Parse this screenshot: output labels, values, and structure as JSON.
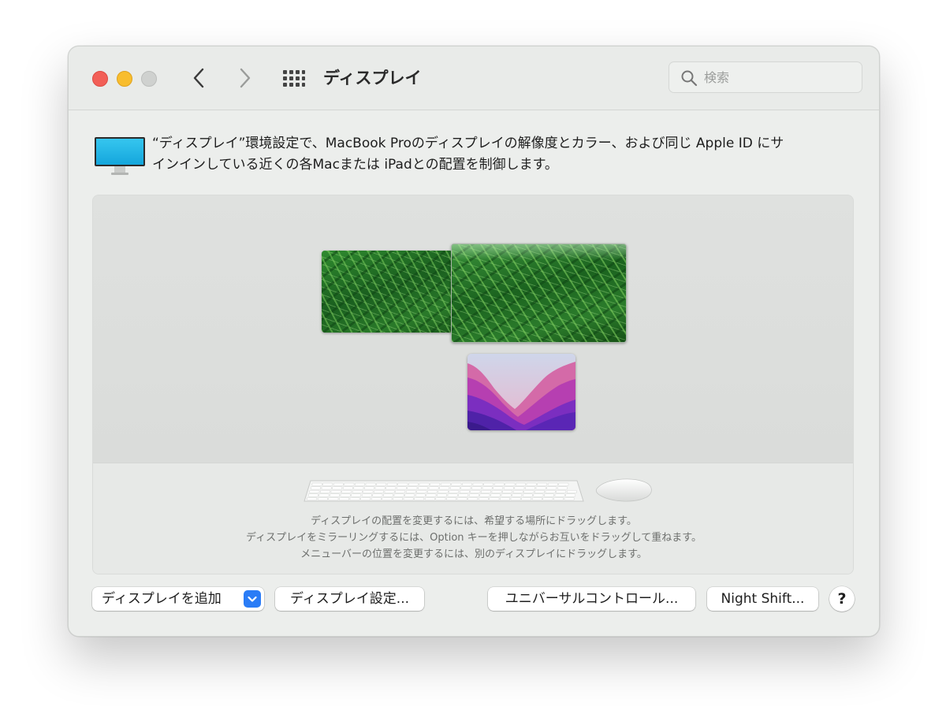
{
  "window": {
    "title": "ディスプレイ",
    "search": {
      "placeholder": "検索",
      "value": ""
    }
  },
  "description": {
    "line1": "“ディスプレイ”環境設定で、MacBook Proのディスプレイの解像度とカラー、および同じ Apple ID にサ",
    "line2": "インインしている近くの各Macまたは iPadとの配置を制御します。"
  },
  "arrangement": {
    "displays": [
      {
        "name": "grass-wallpaper"
      },
      {
        "name": "grass-wallpaper-main"
      },
      {
        "name": "monterey-wallpaper"
      }
    ],
    "hints": [
      "ディスプレイの配置を変更するには、希望する場所にドラッグします。",
      "ディスプレイをミラーリングするには、Option キーを押しながらお互いをドラッグして重ねます。",
      "メニューバーの位置を変更するには、別のディスプレイにドラッグします。"
    ]
  },
  "buttons": {
    "add_display": "ディスプレイを追加",
    "display_settings": "ディスプレイ設定...",
    "universal_control": "ユニバーサルコントロール...",
    "night_shift": "Night Shift...",
    "help": "?"
  },
  "colors": {
    "close": "#f25f57",
    "minimize": "#f8bd2e",
    "zoom_disabled": "#cfd1cf",
    "accent": "#2a7cf6",
    "window_bg": "#eceeec"
  }
}
